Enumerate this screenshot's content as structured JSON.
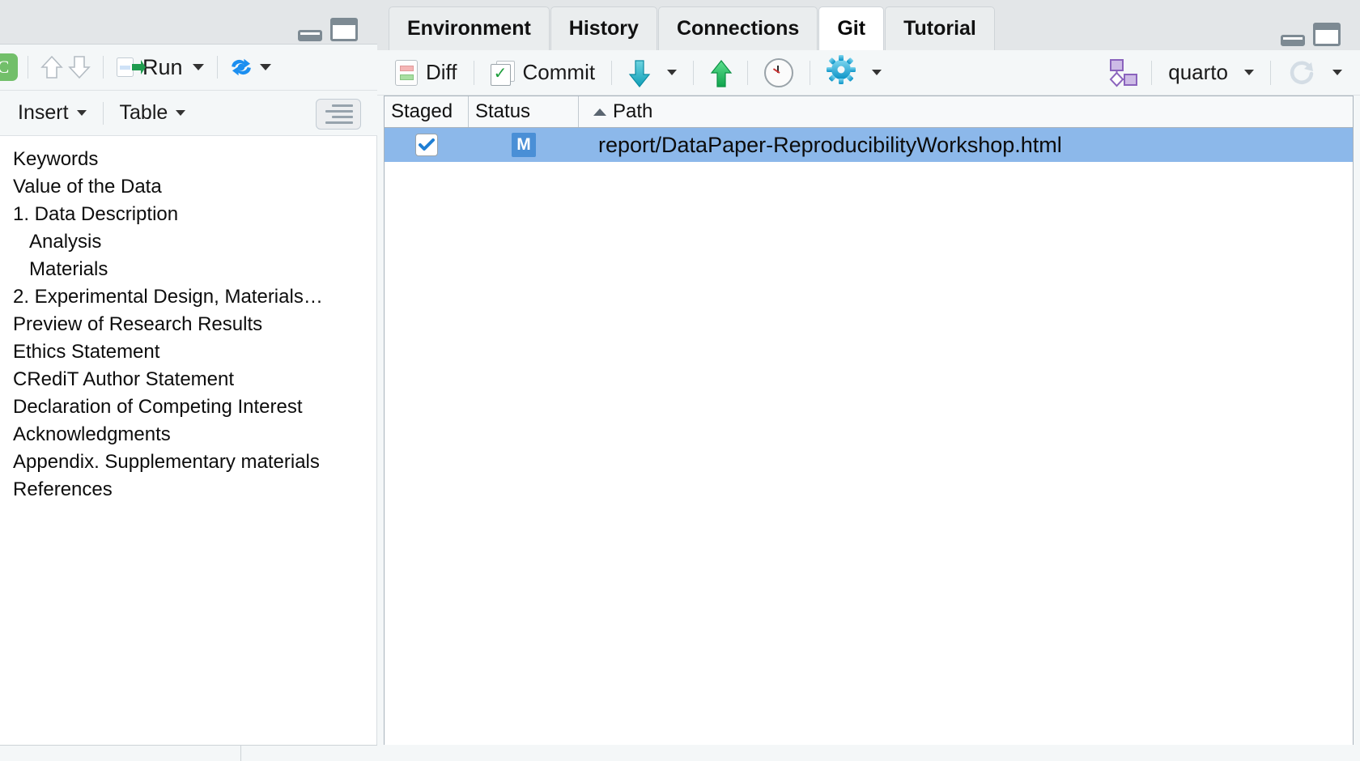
{
  "left_pane": {
    "window_controls": {
      "minimize": "minimize-icon",
      "maximize": "maximize-icon"
    },
    "toolbar": {
      "source_badge": "C",
      "prev_chunk_icon": "up-arrow-icon",
      "next_chunk_icon": "down-arrow-icon",
      "run_label": "Run",
      "run_icon": "run-chunk-icon",
      "knit_icon": "render-icon"
    },
    "toolbar2": {
      "insert_label": "Insert",
      "table_label": "Table",
      "outline_toggle_icon": "outline-toggle-icon"
    },
    "outline": {
      "items": [
        {
          "label": "Keywords",
          "level": 1
        },
        {
          "label": "Value of the Data",
          "level": 1
        },
        {
          "label": "1. Data Description",
          "level": 1
        },
        {
          "label": "Analysis",
          "level": 2
        },
        {
          "label": "Materials",
          "level": 2
        },
        {
          "label": "2. Experimental Design, Materials…",
          "level": 1
        },
        {
          "label": "Preview of Research Results",
          "level": 1
        },
        {
          "label": "Ethics Statement",
          "level": 1
        },
        {
          "label": "CRediT Author Statement",
          "level": 1
        },
        {
          "label": "Declaration of Competing Interest",
          "level": 1
        },
        {
          "label": "Acknowledgments",
          "level": 1
        },
        {
          "label": "Appendix. Supplementary materials",
          "level": 1
        },
        {
          "label": "References",
          "level": 1
        }
      ]
    }
  },
  "right_pane": {
    "tabs": [
      {
        "label": "Environment",
        "active": false
      },
      {
        "label": "History",
        "active": false
      },
      {
        "label": "Connections",
        "active": false
      },
      {
        "label": "Git",
        "active": true
      },
      {
        "label": "Tutorial",
        "active": false
      }
    ],
    "toolbar": {
      "diff_label": "Diff",
      "diff_icon": "diff-icon",
      "commit_label": "Commit",
      "commit_icon": "commit-icon",
      "pull_icon": "pull-down-arrow-icon",
      "push_icon": "push-up-arrow-icon",
      "history_icon": "history-clock-icon",
      "more_icon": "gear-icon",
      "branch_icon": "branch-diagram-icon",
      "branch_name": "quarto",
      "refresh_icon": "refresh-icon"
    },
    "file_table": {
      "columns": [
        "Staged",
        "Status",
        "Path"
      ],
      "sort_column": "Path",
      "sort_direction": "ascending",
      "rows": [
        {
          "staged": true,
          "status": "M",
          "path": "report/DataPaper-ReproducibilityWorkshop.html",
          "selected": true
        }
      ]
    }
  },
  "colors": {
    "selection_blue": "#8cb8ea",
    "status_badge_blue": "#4a8fd6",
    "push_green": "#2ecc71",
    "pull_teal": "#24b0c4",
    "source_badge_green": "#72bf6a",
    "branch_purple": "#9b7dc4"
  }
}
